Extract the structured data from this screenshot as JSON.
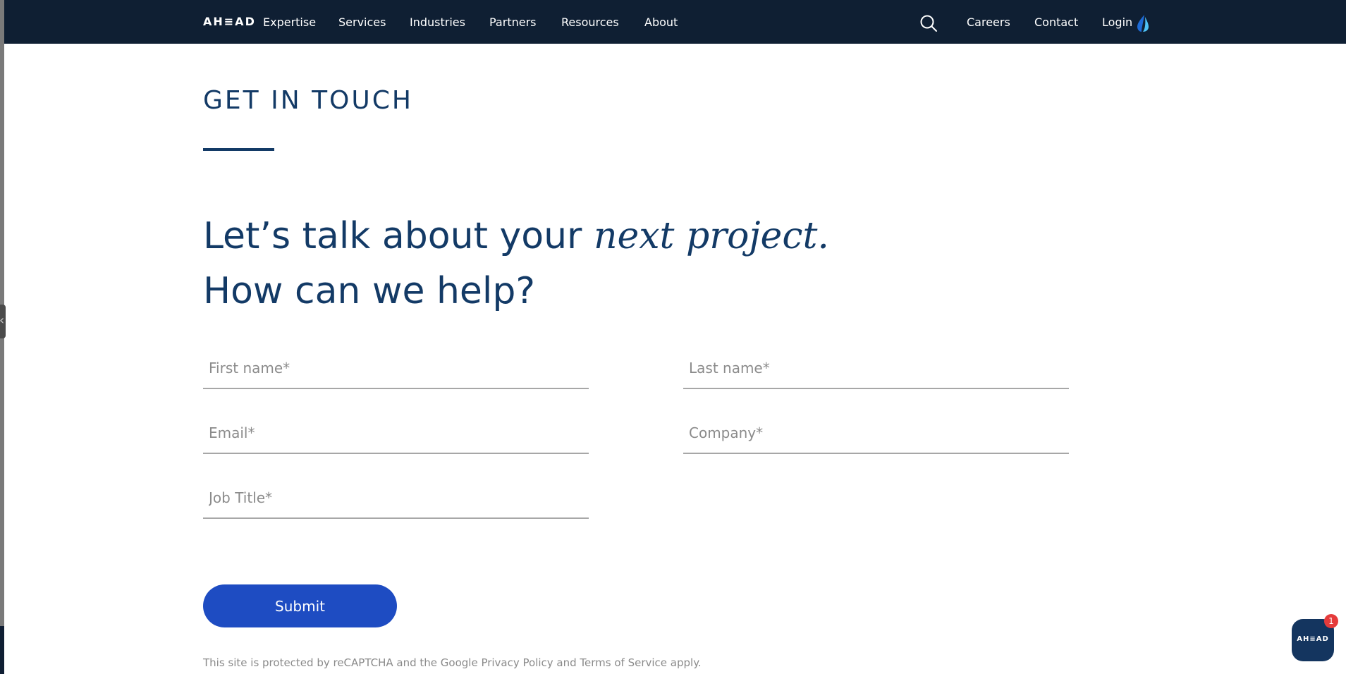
{
  "header": {
    "logo": "AH≡AD",
    "nav": [
      {
        "label": "Expertise"
      },
      {
        "label": "Services"
      },
      {
        "label": "Industries"
      },
      {
        "label": "Partners"
      },
      {
        "label": "Resources"
      },
      {
        "label": "About"
      }
    ],
    "utility": {
      "careers": "Careers",
      "contact": "Contact",
      "login": "Login"
    },
    "icons": {
      "search": "search-icon",
      "login_brand": "ahead-droplet-icon"
    },
    "colors": {
      "bar": "#0f1f33",
      "text": "#ffffff"
    }
  },
  "main": {
    "eyebrow": "GET IN TOUCH",
    "headline_line1": "Let’s talk about your ",
    "headline_italic": "next project.",
    "headline_line2": "How can we help?",
    "form": {
      "first_name_placeholder": "First name*",
      "last_name_placeholder": "Last name*",
      "email_placeholder": "Email*",
      "company_placeholder": "Company*",
      "job_title_placeholder": "Job Title*",
      "submit_label": "Submit"
    },
    "recaptcha_notice": "This site is protected by reCAPTCHA and the Google Privacy Policy and Terms of Service apply.",
    "colors": {
      "heading": "#133a66",
      "button": "#1e4cc2"
    }
  },
  "chat_widget": {
    "label": "AH≡AD",
    "badge_count": "1",
    "colors": {
      "bubble": "#14355f",
      "badge": "#e53b3b"
    }
  },
  "side_panel": {
    "toggle_icon": "chevron-left-icon"
  }
}
